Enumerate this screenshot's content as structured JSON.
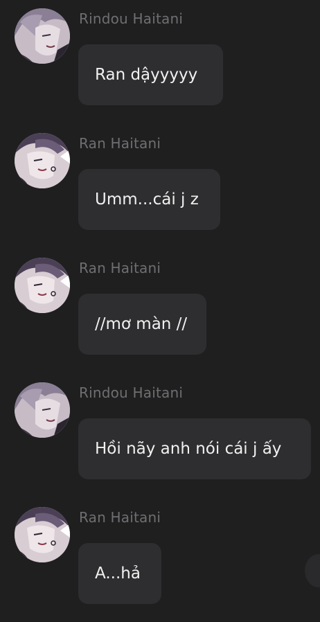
{
  "messages": [
    {
      "sender": "Rindou Haitani",
      "avatar": "rindou-avatar",
      "text": "Ran dậyyyyy"
    },
    {
      "sender": "Ran Haitani",
      "avatar": "ran-avatar",
      "text": "Umm...cái j z"
    },
    {
      "sender": "Ran Haitani",
      "avatar": "ran-avatar",
      "text": "//mơ màn //"
    },
    {
      "sender": "Rindou Haitani",
      "avatar": "rindou-avatar",
      "text": "Hồi nãy anh nói cái j ấy"
    },
    {
      "sender": "Ran Haitani",
      "avatar": "ran-avatar",
      "text": "A...hả"
    }
  ],
  "colors": {
    "background": "#1f1f20",
    "bubble": "#2e2e30",
    "sender_name": "#6f6f72",
    "message_text": "#f1f1f1"
  }
}
